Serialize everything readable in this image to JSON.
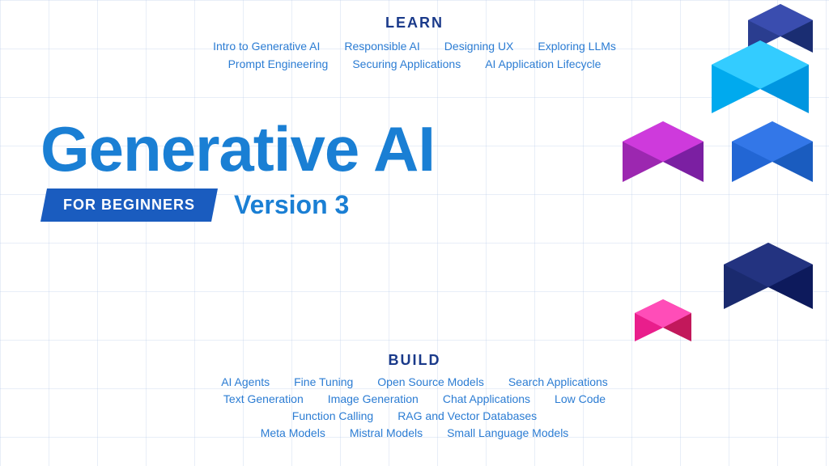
{
  "learn": {
    "section_title": "LEARN",
    "row1": [
      {
        "label": "Intro to Generative AI"
      },
      {
        "label": "Responsible AI"
      },
      {
        "label": "Designing UX"
      },
      {
        "label": "Exploring LLMs"
      }
    ],
    "row2": [
      {
        "label": "Prompt Engineering"
      },
      {
        "label": "Securing Applications"
      },
      {
        "label": "AI Application Lifecycle"
      }
    ]
  },
  "hero": {
    "title": "Generative AI",
    "badge": "FOR BEGINNERS",
    "version": "Version 3"
  },
  "build": {
    "section_title": "BUILD",
    "row1": [
      {
        "label": "AI Agents"
      },
      {
        "label": "Fine Tuning"
      },
      {
        "label": "Open Source Models"
      },
      {
        "label": "Search Applications"
      }
    ],
    "row2": [
      {
        "label": "Text Generation"
      },
      {
        "label": "Image Generation"
      },
      {
        "label": "Chat Applications"
      },
      {
        "label": "Low Code"
      }
    ],
    "row3": [
      {
        "label": "Function Calling"
      },
      {
        "label": "RAG and Vector Databases"
      }
    ],
    "row4": [
      {
        "label": "Meta Models"
      },
      {
        "label": "Mistral Models"
      },
      {
        "label": "Small Language Models"
      }
    ]
  },
  "colors": {
    "accent_blue": "#1a7fd4",
    "dark_blue": "#1a3a8a",
    "badge_bg": "#1a5cbf",
    "link_color": "#2b7cd3"
  }
}
